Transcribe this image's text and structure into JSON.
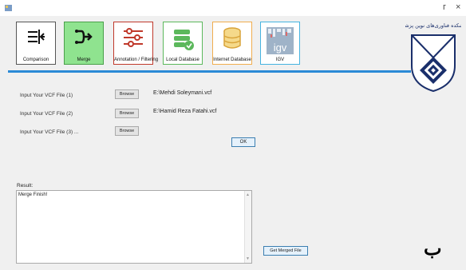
{
  "window": {
    "minimize_glyph": "ᴦ",
    "close_glyph": "×"
  },
  "toolbar": [
    {
      "label": "Comparison",
      "icon": "comparison-icon",
      "bg": "#ffffff",
      "border": "#555555",
      "color": "#111111"
    },
    {
      "label": "Merge",
      "icon": "merge-icon",
      "bg": "#8fe38f",
      "border": "#4aa04a",
      "color": "#111111"
    },
    {
      "label": "Annotation / Filtering",
      "icon": "sliders-icon",
      "bg": "#ffffff",
      "border": "#c0392b",
      "color": "#c0392b"
    },
    {
      "label": "Local Database",
      "icon": "database-check-icon",
      "bg": "#ffffff",
      "border": "#5cb85c",
      "color": "#5cb85c"
    },
    {
      "label": "Internet Database",
      "icon": "database-icon",
      "bg": "#ffffff",
      "border": "#f0ad4e",
      "color": "#e0b040"
    },
    {
      "label": "IGV",
      "icon": "igv-logo-icon",
      "bg": "#ffffff",
      "border": "#45b3e0",
      "color": "#45b3e0"
    }
  ],
  "inputs": [
    {
      "label": "Input Your VCF File (1)",
      "browse": "Browse",
      "path": "E:\\Mehdi Soleymani.vcf"
    },
    {
      "label": "Input Your VCF File (2)",
      "browse": "Browse",
      "path": "E:\\Hamid Reza Fatahi.vcf"
    },
    {
      "label": "Input Your VCF File (3) ...",
      "browse": "Browse",
      "path": ""
    }
  ],
  "ok_label": "OK",
  "result": {
    "label": "Result:",
    "text": "Merge Finish!"
  },
  "get_merged_label": "Get Merged File",
  "corner_letter": "ب",
  "logo_text": "دانشکده فناوری‌های نوین پزشکی"
}
